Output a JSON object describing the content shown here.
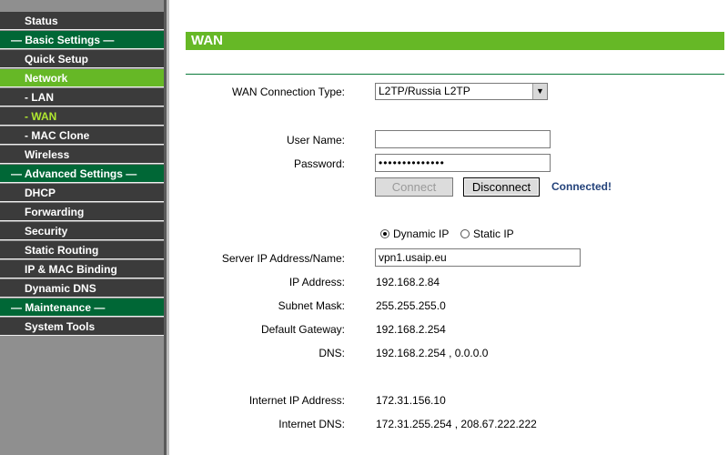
{
  "sidebar": {
    "items": [
      {
        "label": "Status"
      },
      {
        "label": "— Basic Settings —"
      },
      {
        "label": "Quick Setup"
      },
      {
        "label": "Network"
      },
      {
        "label": "- LAN"
      },
      {
        "label": "- WAN"
      },
      {
        "label": "- MAC Clone"
      },
      {
        "label": "Wireless"
      },
      {
        "label": "— Advanced Settings —"
      },
      {
        "label": "DHCP"
      },
      {
        "label": "Forwarding"
      },
      {
        "label": "Security"
      },
      {
        "label": "Static Routing"
      },
      {
        "label": "IP & MAC Binding"
      },
      {
        "label": "Dynamic DNS"
      },
      {
        "label": "— Maintenance —"
      },
      {
        "label": "System Tools"
      }
    ]
  },
  "page": {
    "title": "WAN"
  },
  "form": {
    "wan_type_label": "WAN Connection Type:",
    "wan_type_value": "L2TP/Russia L2TP",
    "username_label": "User Name:",
    "username_value": "",
    "password_label": "Password:",
    "password_value": "••••••••••••••",
    "connect_label": "Connect",
    "disconnect_label": "Disconnect",
    "status": "Connected!",
    "dynamic_ip_label": "Dynamic IP",
    "static_ip_label": "Static IP",
    "server_label": "Server IP Address/Name:",
    "server_value": "vpn1.usaip.eu",
    "ip_label": "IP Address:",
    "ip_value": "192.168.2.84",
    "mask_label": "Subnet Mask:",
    "mask_value": "255.255.255.0",
    "gateway_label": "Default Gateway:",
    "gateway_value": "192.168.2.254",
    "dns_label": "DNS:",
    "dns_value": "192.168.2.254 , 0.0.0.0",
    "internet_ip_label": "Internet IP Address:",
    "internet_ip_value": "172.31.156.10",
    "internet_dns_label": "Internet DNS:",
    "internet_dns_value": "172.31.255.254 , 208.67.222.222"
  },
  "colors": {
    "accent_green": "#66b826",
    "section_green": "#006736",
    "nav_dark": "#3b3b3b",
    "status_blue": "#23427a"
  },
  "icons": {
    "select_arrow": "dropdown-arrow-icon"
  }
}
